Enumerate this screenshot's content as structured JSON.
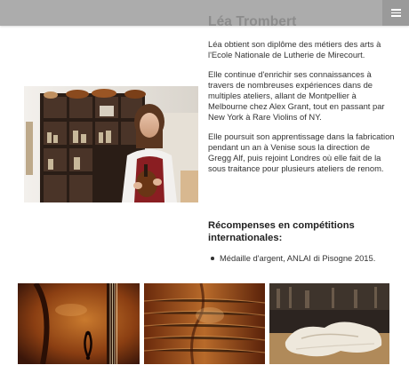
{
  "header": {
    "menu_icon": "hamburger-menu-icon"
  },
  "profile": {
    "name": "Léa Trombert",
    "portrait_alt": "portrait-photo",
    "paragraphs": [
      "Léa obtient son diplôme des métiers des arts à l'Ecole Nationale de Lutherie de Mirecourt.",
      "Elle continue d'enrichir ses connaissances à travers de nombreuses expériences dans de multiples ateliers, allant de Montpellier à Melbourne chez Alex Grant, tout en passant par New York à Rare Violins of NY.",
      "Elle poursuit son apprentissage dans la fabrication pendant un an à Venise sous la direction de Gregg Alf, puis rejoint Londres où elle fait de la sous traitance pour plusieurs ateliers de renom."
    ]
  },
  "awards": {
    "title": "Récompenses en compétitions internationales:",
    "items": [
      "Médaille d'argent, ANLAI di Pisogne 2015."
    ]
  },
  "gallery": {
    "images": [
      "violin-body-photo",
      "violin-back-photo",
      "violin-top-photo"
    ]
  },
  "colors": {
    "topbar": "#a0a0a0",
    "menu_button": "#9a9a9a",
    "title": "#8c8c8c"
  }
}
